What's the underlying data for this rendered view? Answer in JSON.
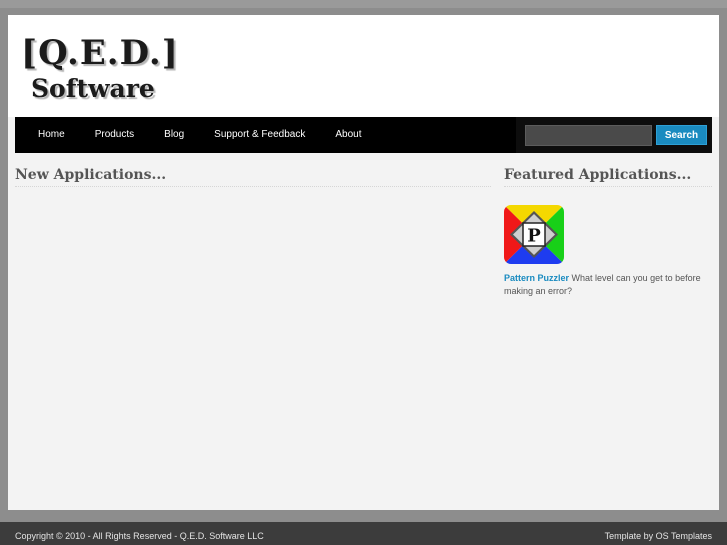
{
  "logo": {
    "line1": "[Q.E.D.]",
    "line2": "Software"
  },
  "nav": {
    "items": [
      {
        "label": "Home"
      },
      {
        "label": "Products"
      },
      {
        "label": "Blog"
      },
      {
        "label": "Support & Feedback"
      },
      {
        "label": "About"
      }
    ]
  },
  "search": {
    "value": "",
    "placeholder": "",
    "button_label": "Search"
  },
  "main": {
    "title": "New Applications..."
  },
  "sidebar": {
    "title": "Featured Applications...",
    "featured": {
      "icon": "pattern-puzzler-app-icon",
      "icon_letter": "P",
      "name": "Pattern Puzzler",
      "description": "What level can you get to before making an error?"
    }
  },
  "footer": {
    "copyright": "Copyright © 2010 - All Rights Reserved - Q.E.D. Software LLC",
    "credit": "Template by OS Templates"
  },
  "colors": {
    "accent": "#1a8bc0",
    "nav_background": "#000000",
    "page_background": "#f3f3f3",
    "outer_background": "#8d8d8d",
    "footer_background": "#3c3c3c"
  }
}
